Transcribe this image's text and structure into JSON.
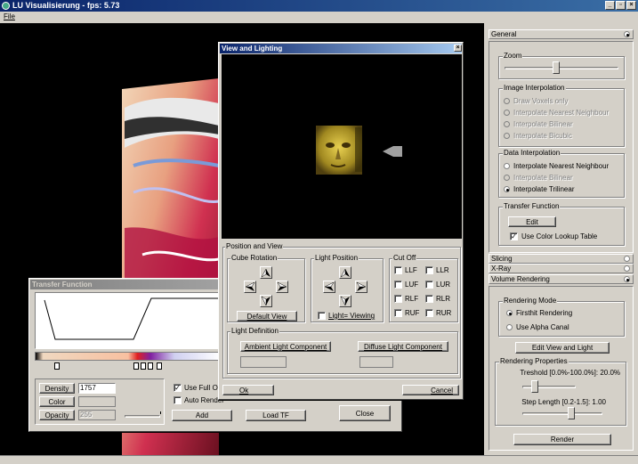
{
  "app": {
    "title": "LU Visualisierung - fps: 5.73",
    "menu": [
      "File"
    ]
  },
  "right_panel": {
    "sections": {
      "general": "General",
      "slicing": "Slicing",
      "xray": "X-Ray",
      "volume_rendering": "Volume Rendering"
    },
    "zoom": {
      "label": "Zoom",
      "value_fraction": 0.45
    },
    "image_interpolation": {
      "label": "Image Interpolation",
      "options": [
        "Draw Voxels only",
        "Interpolate Nearest Neighbour",
        "Interpolate Bilinear",
        "Interpolate Bicubic"
      ]
    },
    "data_interpolation": {
      "label": "Data  Interpolation",
      "options": [
        "Interpolate Nearest Neighbour",
        "Interpolate Bilinear",
        "Interpolate Trilinear"
      ],
      "selected": 2
    },
    "transfer_function": {
      "label": "Transfer Function",
      "edit": "Edit",
      "use_lut": "Use Color Lookup Table",
      "use_lut_checked": true
    },
    "rendering_mode": {
      "label": "Rendering Mode",
      "options": [
        "Firsthit Rendering",
        "Use Alpha Canal"
      ],
      "selected": 0
    },
    "edit_view_light": "Edit View and Light",
    "rendering_properties": {
      "label": "Rendering Properties",
      "treshold": "Treshold [0.0%-100.0%]: 20.0%",
      "treshold_fraction": 0.2,
      "step_length": "Step Length [0.2-1.5]: 1.00",
      "step_fraction": 0.62
    },
    "render": "Render"
  },
  "view_lighting": {
    "title": "View and Lighting",
    "close": "×",
    "position_view": "Position and View",
    "cube_rotation": "Cube Rotation",
    "default_view": "Default View",
    "light_position": "Light Position",
    "light_viewing": "Light= Viewing",
    "cut_off": "Cut Off",
    "cut_items": [
      "LLF",
      "LLR",
      "LUF",
      "LUR",
      "RLF",
      "RLR",
      "RUF",
      "RUR"
    ],
    "light_definition": "Light Definition",
    "ambient": "Ambient Light Component",
    "diffuse": "Diffuse Light Component",
    "ok": "Ok",
    "cancel": "Cancel"
  },
  "transfer_function_win": {
    "title": "Transfer Function",
    "density_label": "Density",
    "density_value": "1757",
    "color_label": "Color",
    "opacity_label": "Opacity",
    "opacity_value": "255",
    "use_full": "Use Full Op",
    "auto_render": "Auto Render",
    "add": "Add",
    "load_tf": "Load TF",
    "close": "Close"
  },
  "icons": [
    "app-icon",
    "minimize-icon",
    "maximize-icon",
    "close-icon"
  ]
}
